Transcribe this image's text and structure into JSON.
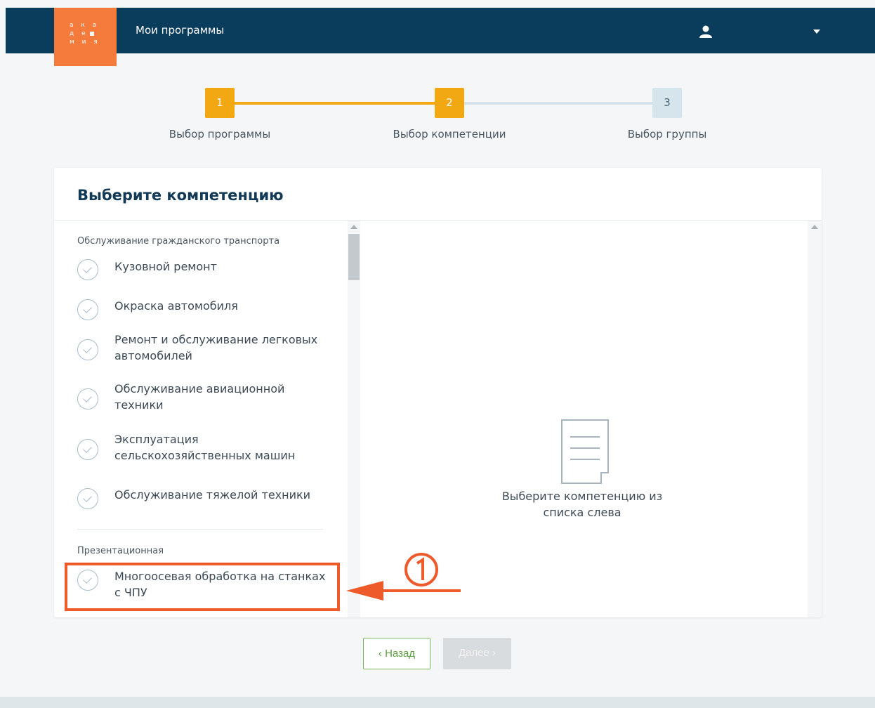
{
  "header": {
    "logo_lines": [
      "а к а",
      "д е",
      "м и я"
    ],
    "title": "Мои программы"
  },
  "stepper": {
    "steps": [
      {
        "number": "1",
        "label": "Выбор программы",
        "state": "done"
      },
      {
        "number": "2",
        "label": "Выбор компетенции",
        "state": "active"
      },
      {
        "number": "3",
        "label": "Выбор группы",
        "state": "pending"
      }
    ]
  },
  "card": {
    "title": "Выберите компетенцию",
    "categories": [
      {
        "label": "Обслуживание гражданского транспорта",
        "items": [
          "Кузовной ремонт",
          "Окраска автомобиля",
          "Ремонт и обслуживание легковых автомобилей",
          "Обслуживание авиационной техники",
          "Эксплуатация сельскохозяйственных машин",
          "Обслуживание тяжелой техники"
        ]
      },
      {
        "label": "Презентационная",
        "items": [
          "Многоосевая обработка на станках с ЧПУ"
        ]
      }
    ],
    "empty_state": "Выберите компетенцию из списка слева"
  },
  "annotation": {
    "marker": "①"
  },
  "buttons": {
    "back": "‹ Назад",
    "next": "Далее ›"
  },
  "colors": {
    "header": "#0a3c5c",
    "logo": "#f47b3b",
    "step_active": "#f2a812",
    "highlight": "#ef5a2a",
    "back_button": "#7ab55c"
  }
}
